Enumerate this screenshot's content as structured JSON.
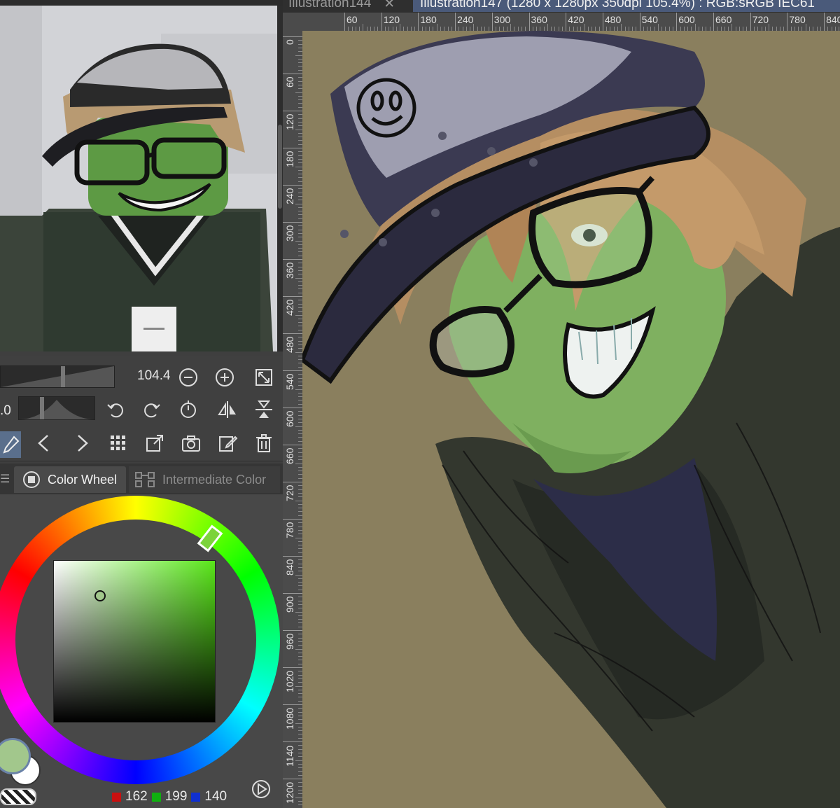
{
  "document_tabs": [
    {
      "label": "Illustration144",
      "active": false,
      "close": "✕"
    },
    {
      "label": "Illustration147 (1280 x 1280px 350dpi 105.4%) : RGB:sRGB IEC61",
      "active": true
    }
  ],
  "navigator": {
    "zoom_value": "104.4",
    "rotation_value": ".0"
  },
  "tool_icons": [
    "eyedropper-icon",
    "chevron-left-icon",
    "chevron-right-icon",
    "grid-icon",
    "export-icon",
    "camera-icon",
    "edit-icon",
    "trash-icon"
  ],
  "palette_tabs": [
    {
      "label": "Color Wheel",
      "active": true
    },
    {
      "label": "Intermediate Color",
      "active": false
    }
  ],
  "color": {
    "r": "162",
    "g": "199",
    "b": "140",
    "current_hex": "#a2c78c",
    "hue_hex": "#59e619"
  },
  "ruler_h": [
    "60",
    "120",
    "180",
    "240",
    "300",
    "360",
    "420",
    "480",
    "540",
    "600",
    "660",
    "720",
    "780",
    "840"
  ],
  "ruler_v": [
    "0",
    "60",
    "120",
    "180",
    "240",
    "300",
    "360",
    "420",
    "480",
    "540",
    "600",
    "660",
    "720",
    "780",
    "840",
    "900",
    "960",
    "1020",
    "1080",
    "1140",
    "1200"
  ],
  "colors": {
    "canvas_bg": "#8a7f5e",
    "skin": "#7fb060",
    "cap": "#3b3a52",
    "hair": "#c49a6a"
  }
}
